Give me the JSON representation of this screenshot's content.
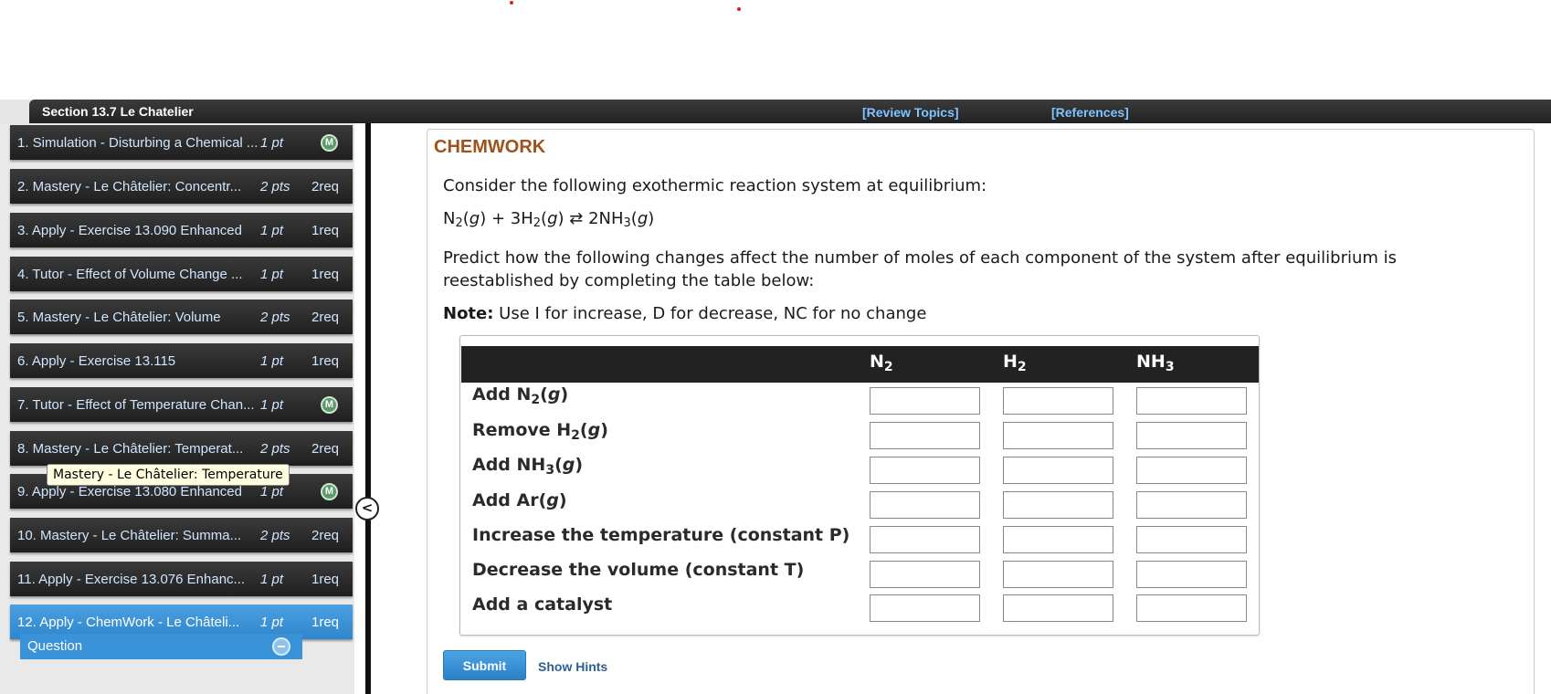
{
  "colors": {
    "accent_blue": "#3a93d8",
    "brand": "#a0521d",
    "header_dark": "#222222",
    "link_blue": "#7fc3ff"
  },
  "header": {
    "section_title": "Section 13.7 Le Chatelier",
    "review_topics": "[Review Topics]",
    "references": "[References]"
  },
  "sidebar": {
    "items": [
      {
        "label": "1. Simulation - Disturbing a Chemical ...",
        "pts": "1 pt",
        "req": "",
        "badge": "M"
      },
      {
        "label": "2. Mastery - Le Châtelier: Concentr...",
        "pts": "2 pts",
        "req": "2req",
        "badge": ""
      },
      {
        "label": "3. Apply - Exercise 13.090 Enhanced",
        "pts": "1 pt",
        "req": "1req",
        "badge": ""
      },
      {
        "label": "4. Tutor - Effect of Volume Change ...",
        "pts": "1 pt",
        "req": "1req",
        "badge": ""
      },
      {
        "label": "5. Mastery - Le Châtelier: Volume",
        "pts": "2 pts",
        "req": "2req",
        "badge": ""
      },
      {
        "label": "6. Apply - Exercise 13.115",
        "pts": "1 pt",
        "req": "1req",
        "badge": ""
      },
      {
        "label": "7. Tutor - Effect of Temperature Chan...",
        "pts": "1 pt",
        "req": "",
        "badge": "M"
      },
      {
        "label": "8. Mastery - Le Châtelier: Temperat...",
        "pts": "2 pts",
        "req": "2req",
        "badge": ""
      },
      {
        "label": "9. Apply - Exercise 13.080 Enhanced",
        "pts": "1 pt",
        "req": "",
        "badge": "M"
      },
      {
        "label": "10. Mastery - Le Châtelier: Summa...",
        "pts": "2 pts",
        "req": "2req",
        "badge": ""
      },
      {
        "label": "11. Apply - Exercise 13.076 Enhanc...",
        "pts": "1 pt",
        "req": "1req",
        "badge": ""
      },
      {
        "label": "12. Apply - ChemWork - Le Châteli...",
        "pts": "1 pt",
        "req": "1req",
        "badge": ""
      }
    ],
    "sub_item": "Question",
    "tooltip": "Mastery - Le Châtelier: Temperature",
    "collapse_glyph": "<"
  },
  "main": {
    "brand": "CHEMWORK",
    "intro": "Consider the following exothermic reaction system at equilibrium:",
    "equation": {
      "n": "N",
      "n_sub": "2",
      "g1": "(g) + 3H",
      "h_sub": "2",
      "g2": "(g) ⇄ 2NH",
      "nh_sub": "3",
      "g3": "(g)"
    },
    "predict": "Predict how the following changes affect the number of moles of each component of the system after equilibrium is reestablished by completing the table below:",
    "note_label": "Note:",
    "note_text": " Use I for increase, D for decrease, NC for no change",
    "columns": [
      {
        "base": "N",
        "sub": "2"
      },
      {
        "base": "H",
        "sub": "2"
      },
      {
        "base": "NH",
        "sub": "3"
      }
    ],
    "rows": [
      {
        "pre": "Add N",
        "sub": "2",
        "post": "(g)"
      },
      {
        "pre": "Remove H",
        "sub": "2",
        "post": "(g)"
      },
      {
        "pre": "Add NH",
        "sub": "3",
        "post": "(g)"
      },
      {
        "pre": "Add Ar(g)",
        "sub": "",
        "post": ""
      },
      {
        "pre": "Increase the temperature (constant P)",
        "sub": "",
        "post": ""
      },
      {
        "pre": "Decrease the volume (constant T)",
        "sub": "",
        "post": ""
      },
      {
        "pre": "Add a catalyst",
        "sub": "",
        "post": ""
      }
    ],
    "submit": "Submit",
    "hints": "Show Hints"
  }
}
